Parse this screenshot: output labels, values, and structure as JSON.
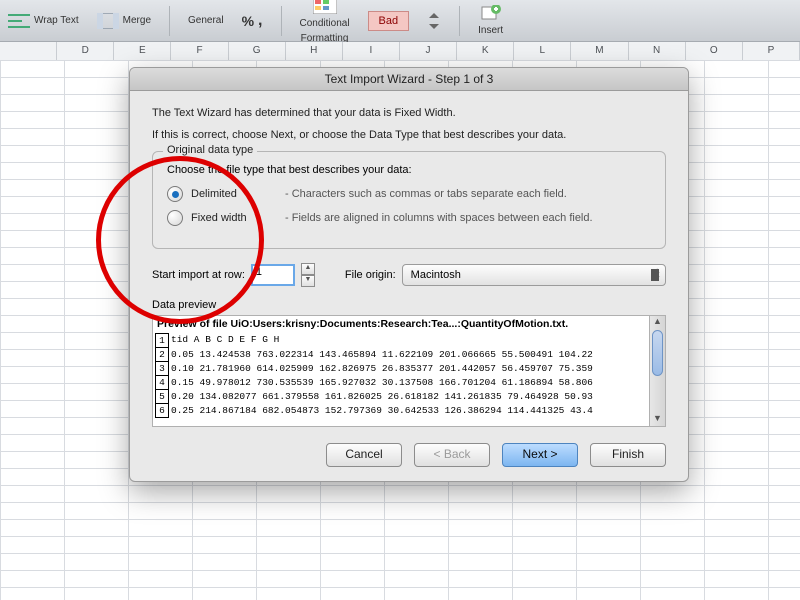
{
  "ribbon": {
    "wrap_label": "Wrap Text",
    "merge_label": "Merge",
    "general_label": "General",
    "percent_icon": "%",
    "cond_label": "Conditional",
    "cond_label2": "Formatting",
    "bad_label": "Bad",
    "insert_label": "Insert"
  },
  "columns": [
    "",
    "D",
    "E",
    "F",
    "G",
    "H",
    "I",
    "J",
    "K",
    "L",
    "M",
    "N",
    "O",
    "P"
  ],
  "dialog": {
    "title": "Text Import Wizard - Step 1 of 3",
    "intro1": "The Text Wizard has determined that your data is Fixed Width.",
    "intro2": "If this is correct, choose Next, or choose the Data Type that best describes your data.",
    "legend": "Original data type",
    "instruction": "Choose the file type that best describes your data:",
    "delimited": {
      "name": "Delimited",
      "desc": "- Characters such as commas or tabs separate each field."
    },
    "fixed": {
      "name": "Fixed width",
      "desc": "- Fields are aligned in columns with spaces between each field."
    },
    "start_label": "Start import at row:",
    "start_value": "1",
    "origin_label": "File origin:",
    "origin_value": "Macintosh",
    "preview_label": "Data preview",
    "preview_title": "Preview of file UiO:Users:krisny:Documents:Research:Tea...:QuantityOfMotion.txt.",
    "preview_rows": [
      {
        "n": "1",
        "t": "tid A B C D E F G H"
      },
      {
        "n": "2",
        "t": "0.05 13.424538 763.022314 143.465894 11.622109 201.066665 55.500491 104.22"
      },
      {
        "n": "3",
        "t": "0.10 21.781960 614.025909 162.826975 26.835377 201.442057 56.459707 75.359"
      },
      {
        "n": "4",
        "t": "0.15 49.978012 730.535539 165.927032 30.137508 166.701204 61.186894 58.806"
      },
      {
        "n": "5",
        "t": "0.20 134.082077 661.379558 161.826025 26.618182 141.261835 79.464928 50.93"
      },
      {
        "n": "6",
        "t": "0.25 214.867184 682.054873 152.797369 30.642533 126.386294 114.441325 43.4"
      }
    ],
    "buttons": {
      "cancel": "Cancel",
      "back": "< Back",
      "next": "Next >",
      "finish": "Finish"
    }
  }
}
